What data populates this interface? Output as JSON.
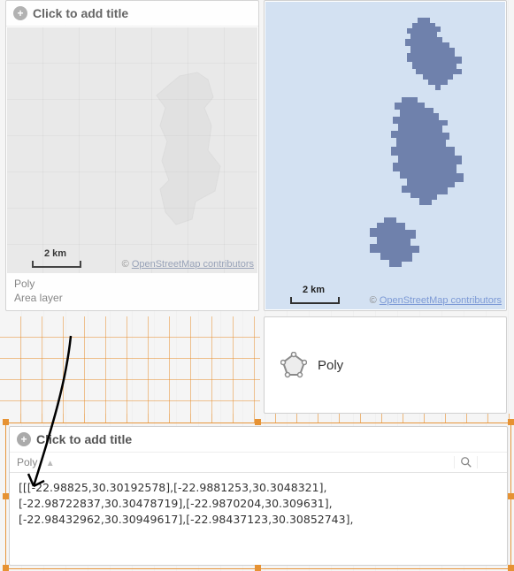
{
  "panel_left": {
    "title_placeholder": "Click to add title",
    "scale_label": "2 km",
    "attribution_prefix": "© ",
    "attribution_link": "OpenStreetMap contributors",
    "footer_line1": "Poly",
    "footer_line2": "Area layer"
  },
  "panel_right": {
    "scale_label": "2 km",
    "attribution_prefix": "© ",
    "attribution_link": "OpenStreetMap contributors"
  },
  "legend": {
    "label": "Poly"
  },
  "table_panel": {
    "title_placeholder": "Click to add title",
    "column_label": "Poly",
    "cell_text": "[[[-22.98825,30.30192578],[-22.9881253,30.3048321],\n[-22.98722837,30.30478719],[-22.9870204,30.309631],\n[-22.98432962,30.30949617],[-22.98437123,30.30852743],"
  }
}
